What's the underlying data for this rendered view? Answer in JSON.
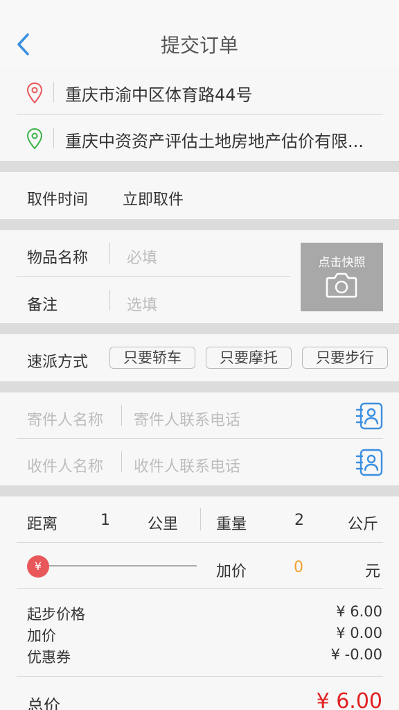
{
  "nav": {
    "title": "提交订单",
    "back_icon": "chevron-left-icon"
  },
  "addresses": {
    "from": "重庆市渝中区体育路44号",
    "to": "重庆中资资产评估土地房地产估价有限..."
  },
  "pickup": {
    "label": "取件时间",
    "value": "立即取件"
  },
  "item": {
    "name_label": "物品名称",
    "name_placeholder": "必填",
    "note_label": "备注",
    "note_placeholder": "选填",
    "photo_label": "点击快照"
  },
  "delivery": {
    "label": "速派方式",
    "options": [
      "只要轿车",
      "只要摩托",
      "只要步行"
    ]
  },
  "contacts": {
    "sender_name": "寄件人名称",
    "sender_phone": "寄件人联系电话",
    "receiver_name": "收件人名称",
    "receiver_phone": "收件人联系电话"
  },
  "metrics": {
    "distance_label": "距离",
    "distance_value": "1",
    "distance_unit": "公里",
    "weight_label": "重量",
    "weight_value": "2",
    "weight_unit": "公斤"
  },
  "markup": {
    "knob_symbol": "¥",
    "label": "加价",
    "value": "0",
    "unit": "元",
    "slider_level": 0
  },
  "fees": [
    {
      "label": "起步价格",
      "value": "¥ 6.00"
    },
    {
      "label": "加价",
      "value": "¥ 0.00"
    },
    {
      "label": "优惠券",
      "value": "¥ -0.00"
    }
  ],
  "total": {
    "label": "总价",
    "value": "¥ 6.00"
  },
  "colors": {
    "accent_blue": "#3b8fe0",
    "price_red": "#e02020",
    "markup_orange": "#f0a030",
    "pin_red": "#e8575a",
    "pin_green": "#3bb34a"
  }
}
